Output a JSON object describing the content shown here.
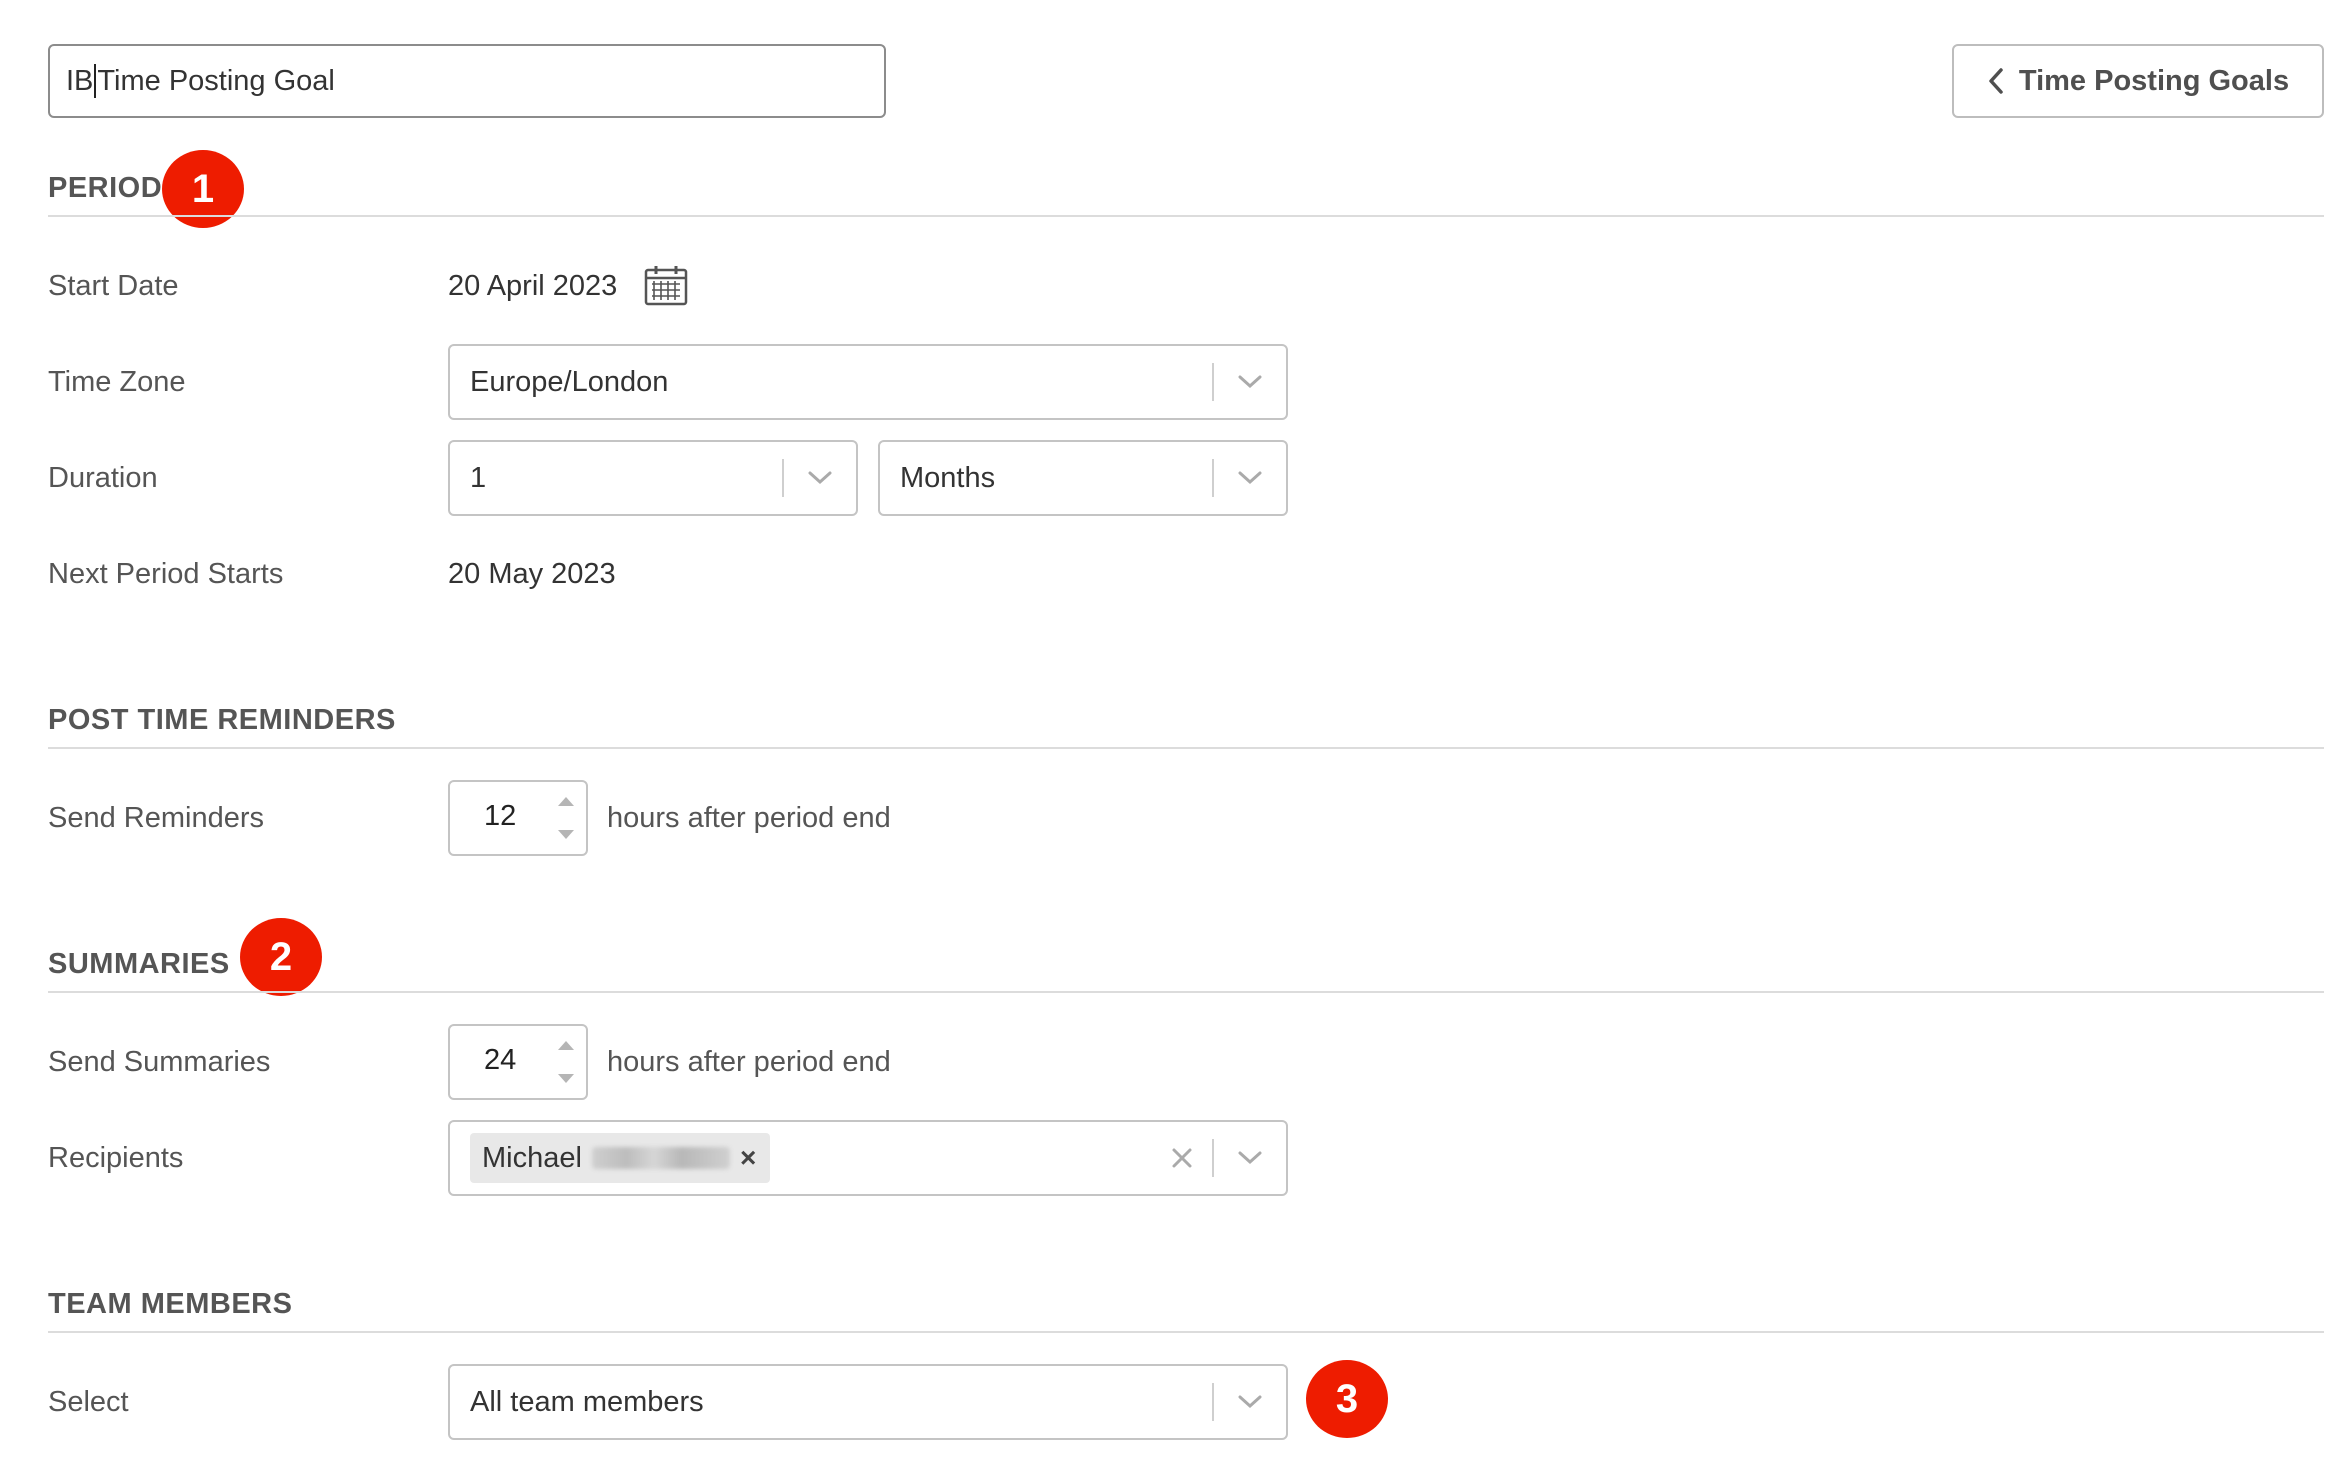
{
  "header": {
    "title_prefix": "IB",
    "title_rest": "Time Posting Goal",
    "back_label": "Time Posting Goals"
  },
  "period": {
    "title": "PERIOD",
    "badge": "1",
    "start_date_label": "Start Date",
    "start_date_value": "20 April 2023",
    "time_zone_label": "Time Zone",
    "time_zone_value": "Europe/London",
    "duration_label": "Duration",
    "duration_value": "1",
    "duration_unit": "Months",
    "next_period_label": "Next Period Starts",
    "next_period_value": "20 May 2023"
  },
  "reminders": {
    "title": "POST TIME REMINDERS",
    "send_label": "Send Reminders",
    "hours": "12",
    "suffix": "hours after period end"
  },
  "summaries": {
    "title": "SUMMARIES",
    "badge": "2",
    "send_label": "Send Summaries",
    "hours": "24",
    "suffix": "hours after period end",
    "recipients_label": "Recipients",
    "recipient_first_name": "Michael",
    "recipient_remove": "×"
  },
  "team": {
    "title": "TEAM MEMBERS",
    "badge": "3",
    "select_label": "Select",
    "select_value": "All team members"
  },
  "icons": {
    "calendar": "calendar-icon",
    "chevron_down": "chevron-down-icon",
    "chevron_left": "chevron-left-icon",
    "clear": "clear-icon",
    "spin_up": "spin-up-icon",
    "spin_down": "spin-down-icon"
  },
  "colors": {
    "badge": "#ee1c00",
    "border": "#c4c4c4",
    "section_text": "#555555"
  }
}
